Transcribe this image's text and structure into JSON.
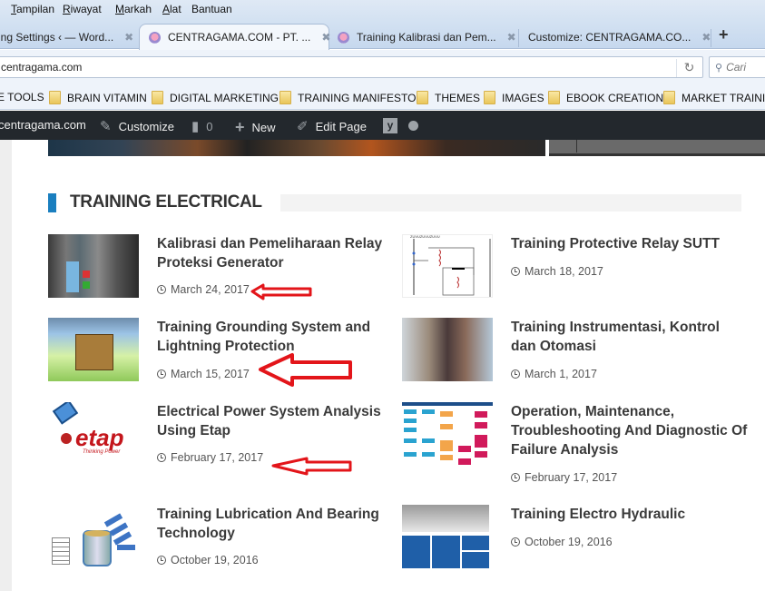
{
  "menubar": {
    "items": [
      "Tampilan",
      "Riwayat",
      "Markah",
      "Alat",
      "Bantuan"
    ],
    "mnemonics": [
      "T",
      "R",
      "M",
      "A",
      "n"
    ]
  },
  "tabs": [
    {
      "label": "ing Settings ‹ — Word...",
      "active": false,
      "favicon": false
    },
    {
      "label": "CENTRAGAMA.COM - PT. ...",
      "active": true,
      "favicon": true
    },
    {
      "label": "Training Kalibrasi dan Pem...",
      "active": false,
      "favicon": true
    },
    {
      "label": "Customize: CENTRAGAMA.CO...",
      "active": false,
      "favicon": false
    }
  ],
  "tab_close_glyph": "✖",
  "new_tab_glyph": "+",
  "navbar": {
    "url": "centragama.com",
    "reload_glyph": "↻",
    "search_placeholder": "Cari",
    "search_glyph": "🔍"
  },
  "bookmarks": [
    "E TOOLS",
    "BRAIN VITAMIN",
    "DIGITAL MARKETING",
    "TRAINING MANIFESTO",
    "THEMES",
    "IMAGES",
    "EBOOK CREATION",
    "MARKET TRAINING"
  ],
  "adminbar": {
    "site": "centragama.com",
    "customize": "Customize",
    "comments_count": "0",
    "new": "New",
    "edit_page": "Edit Page",
    "yoast_glyph": "y",
    "icons": {
      "customize": "✎",
      "comments": "▮",
      "new": "+",
      "edit": "✐"
    }
  },
  "section": {
    "title": "TRAINING ELECTRICAL",
    "accent_color": "#1a7fbf"
  },
  "posts": [
    {
      "title": "Kalibrasi dan Pemeliharaan Relay Proteksi Generator",
      "date": "March 24, 2017",
      "highlighted": true
    },
    {
      "title": "Training Protective Relay SUTT",
      "date": "March 18, 2017",
      "highlighted": false
    },
    {
      "title": "Training Grounding System and Lightning Protection",
      "date": "March 15, 2017",
      "highlighted": true
    },
    {
      "title": "Training Instrumentasi, Kontrol dan Otomasi",
      "date": "March 1, 2017",
      "highlighted": false
    },
    {
      "title": "Electrical Power System Analysis Using Etap",
      "date": "February 17, 2017",
      "highlighted": true
    },
    {
      "title": "Operation, Maintenance, Troubleshooting And Diagnostic Of Failure Analysis",
      "date": "February 17, 2017",
      "highlighted": false
    },
    {
      "title": "Training Lubrication And Bearing Technology",
      "date": "October 19, 2016",
      "highlighted": false
    },
    {
      "title": "Training Electro Hydraulic",
      "date": "October 19, 2016",
      "highlighted": false
    }
  ],
  "thumbnail_labels": {
    "etap_word": "etap",
    "etap_tagline": "Thinking Power"
  },
  "annotation_color": "#e3151a"
}
